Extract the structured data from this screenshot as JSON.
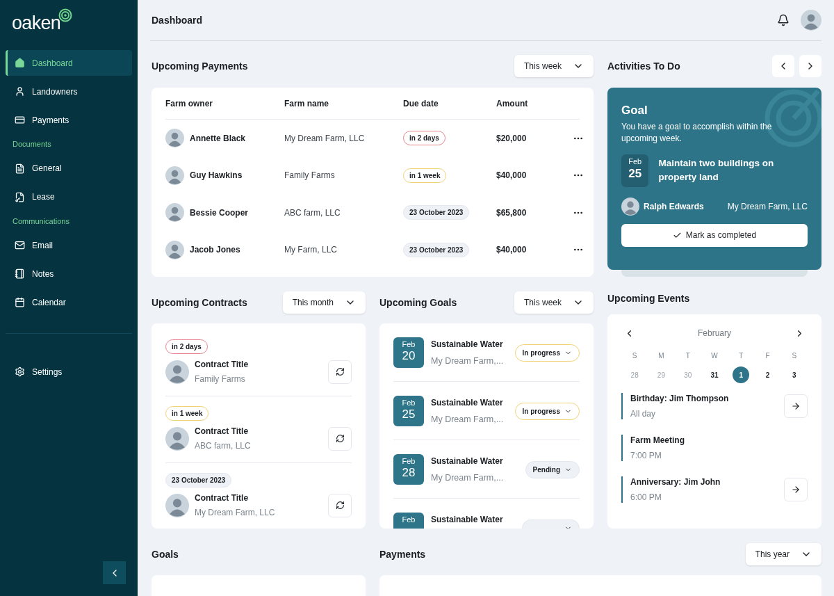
{
  "sidebar": {
    "logo": "oaken",
    "items": [
      {
        "kind": "link",
        "label": "Dashboard",
        "selected": true
      },
      {
        "kind": "link",
        "label": "Landowners",
        "selected": false
      },
      {
        "kind": "link",
        "label": "Payments",
        "selected": false
      },
      {
        "kind": "heading",
        "label": "Documents"
      },
      {
        "kind": "link",
        "label": "General",
        "selected": false
      },
      {
        "kind": "link",
        "label": "Lease",
        "selected": false
      },
      {
        "kind": "heading",
        "label": "Communications"
      },
      {
        "kind": "link",
        "label": "Email",
        "selected": false
      },
      {
        "kind": "link",
        "label": "Notes",
        "selected": false
      },
      {
        "kind": "link",
        "label": "Calendar",
        "selected": false
      }
    ],
    "settings": "Settings"
  },
  "header": {
    "title": "Dashboard"
  },
  "upcoming_payments": {
    "title": "Upcoming Payments",
    "filter": "This week",
    "columns": [
      "Farm owner",
      "Farm name",
      "Due date",
      "Amount"
    ],
    "rows": [
      {
        "owner": "Annette Black",
        "farm": "My Dream Farm, LLC",
        "due": "in 2 days",
        "color": "#e7828c",
        "amount": "$20,000"
      },
      {
        "owner": "Guy Hawkins",
        "farm": "Family Farms",
        "due": "in 1 week",
        "color": "#f0d277",
        "amount": "$40,000"
      },
      {
        "owner": "Bessie Cooper",
        "farm": "ABC farm, LLC",
        "due": "23 October 2023",
        "color": "#e2e7ee",
        "amount": "$65,800"
      },
      {
        "owner": "Jacob Jones",
        "farm": "My Farm, LLC",
        "due": "23 October 2023",
        "color": "#e2e7ee",
        "amount": "$40,000"
      }
    ]
  },
  "upcoming_contracts": {
    "title": "Upcoming Contracts",
    "filter": "This month",
    "items": [
      {
        "due": "in 2 days",
        "color": "#e7828c",
        "title": "Contract Title",
        "farm": "Family Farms"
      },
      {
        "due": "in 1 week",
        "color": "#f0d277",
        "title": "Contract Title",
        "farm": "ABC farm, LLC"
      },
      {
        "due": "23 October 2023",
        "color": "#e2e7ee",
        "title": "Contract Title",
        "farm": "My Dream Farm, LLC"
      }
    ]
  },
  "upcoming_goals": {
    "title": "Upcoming Goals",
    "filter": "This week",
    "items": [
      {
        "month": "Feb",
        "day": "20",
        "title": "Sustainable Water",
        "farm": "My Dream Farm,...",
        "status": "In progress",
        "color": "#f0d277"
      },
      {
        "month": "Feb",
        "day": "25",
        "title": "Sustainable Water",
        "farm": "My Dream Farm,...",
        "status": "In progress",
        "color": "#f0d277"
      },
      {
        "month": "Feb",
        "day": "28",
        "title": "Sustainable Water",
        "farm": "My Dream Farm,...",
        "status": "Pending",
        "color": "#e2e7ee"
      },
      {
        "month": "Feb",
        "title": "Sustainable Water",
        "color": "#e2e7ee"
      }
    ]
  },
  "activities": {
    "title": "Activities To Do",
    "goal": {
      "heading": "Goal",
      "text": "You have a goal to accomplish within the upcoming week.",
      "month": "Feb",
      "day": "25",
      "task": "Maintain two buildings on property land",
      "person": "Ralph Edwards",
      "farm": "My Dream Farm, LLC",
      "button": "Mark as completed"
    }
  },
  "upcoming_events": {
    "title": "Upcoming Events",
    "month": "February",
    "weekdays": [
      "S",
      "M",
      "T",
      "W",
      "T",
      "F",
      "S"
    ],
    "days": [
      {
        "label": "28",
        "muted": true,
        "selected": false
      },
      {
        "label": "29",
        "muted": true,
        "selected": false
      },
      {
        "label": "30",
        "muted": true,
        "selected": false
      },
      {
        "label": "31",
        "muted": false,
        "selected": false
      },
      {
        "label": "1",
        "muted": false,
        "selected": true
      },
      {
        "label": "2",
        "muted": false,
        "selected": false
      },
      {
        "label": "3",
        "muted": false,
        "selected": false
      }
    ],
    "events": [
      {
        "title": "Birthday: Jim Thompson",
        "time": "All day",
        "action": true
      },
      {
        "title": "Farm Meeting",
        "time": "7:00 PM",
        "action": false
      },
      {
        "title": "Anniversary: Jim John",
        "time": "6:00 PM",
        "action": true
      }
    ]
  },
  "goals": {
    "title": "Goals"
  },
  "payments": {
    "title": "Payments",
    "filter": "This year"
  }
}
